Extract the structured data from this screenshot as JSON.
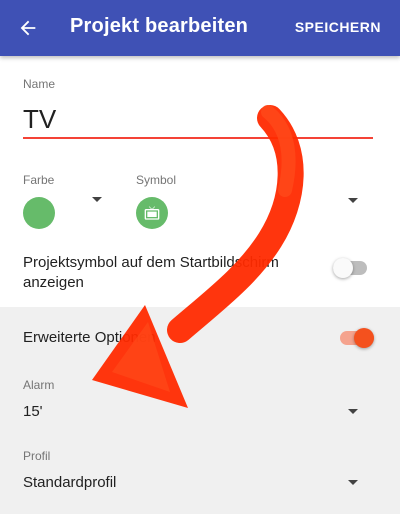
{
  "appbar": {
    "title": "Projekt bearbeiten",
    "save_label": "SPEICHERN",
    "back_icon": "arrow-left-icon"
  },
  "form": {
    "name_label": "Name",
    "name_value": "TV",
    "color_label": "Farbe",
    "symbol_label": "Symbol",
    "homescreen_label": "Projektsymbol auf dem Startbildschirm anzeigen",
    "homescreen_enabled": false
  },
  "advanced": {
    "label": "Erweiterte Optionen",
    "enabled": true,
    "alarm_label": "Alarm",
    "alarm_value": "15'",
    "profile_label": "Profil",
    "profile_value": "Standardprofil"
  },
  "colors": {
    "primary": "#3f51b5",
    "accent": "#f44336",
    "project_color": "#66bb6a",
    "overlay_arrow": "#ff2a00"
  }
}
